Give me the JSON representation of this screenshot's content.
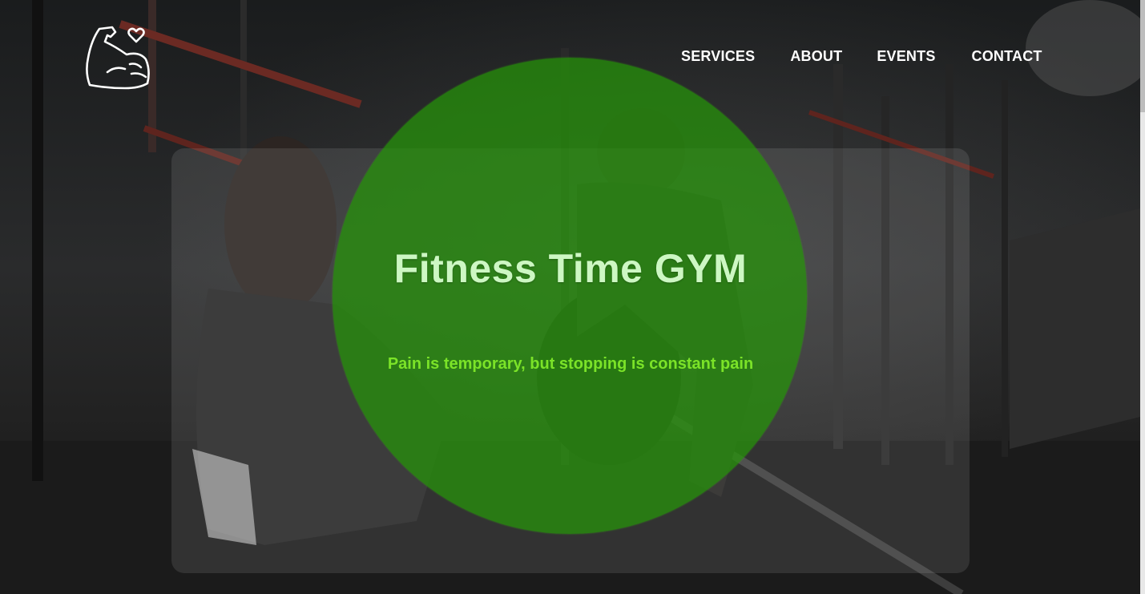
{
  "header": {
    "logo_icon": "flexed-arm-heart-icon",
    "nav": {
      "services": "SERVICES",
      "about": "ABOUT",
      "events": "EVENTS",
      "contact": "CONTACT"
    }
  },
  "hero": {
    "title": "Fitness Time GYM",
    "tagline": "Pain is temporary, but stopping is constant pain"
  },
  "colors": {
    "nav_text": "#ffffff",
    "title": "#cdf7c3",
    "tagline": "#7be328",
    "blob": "#269608"
  }
}
